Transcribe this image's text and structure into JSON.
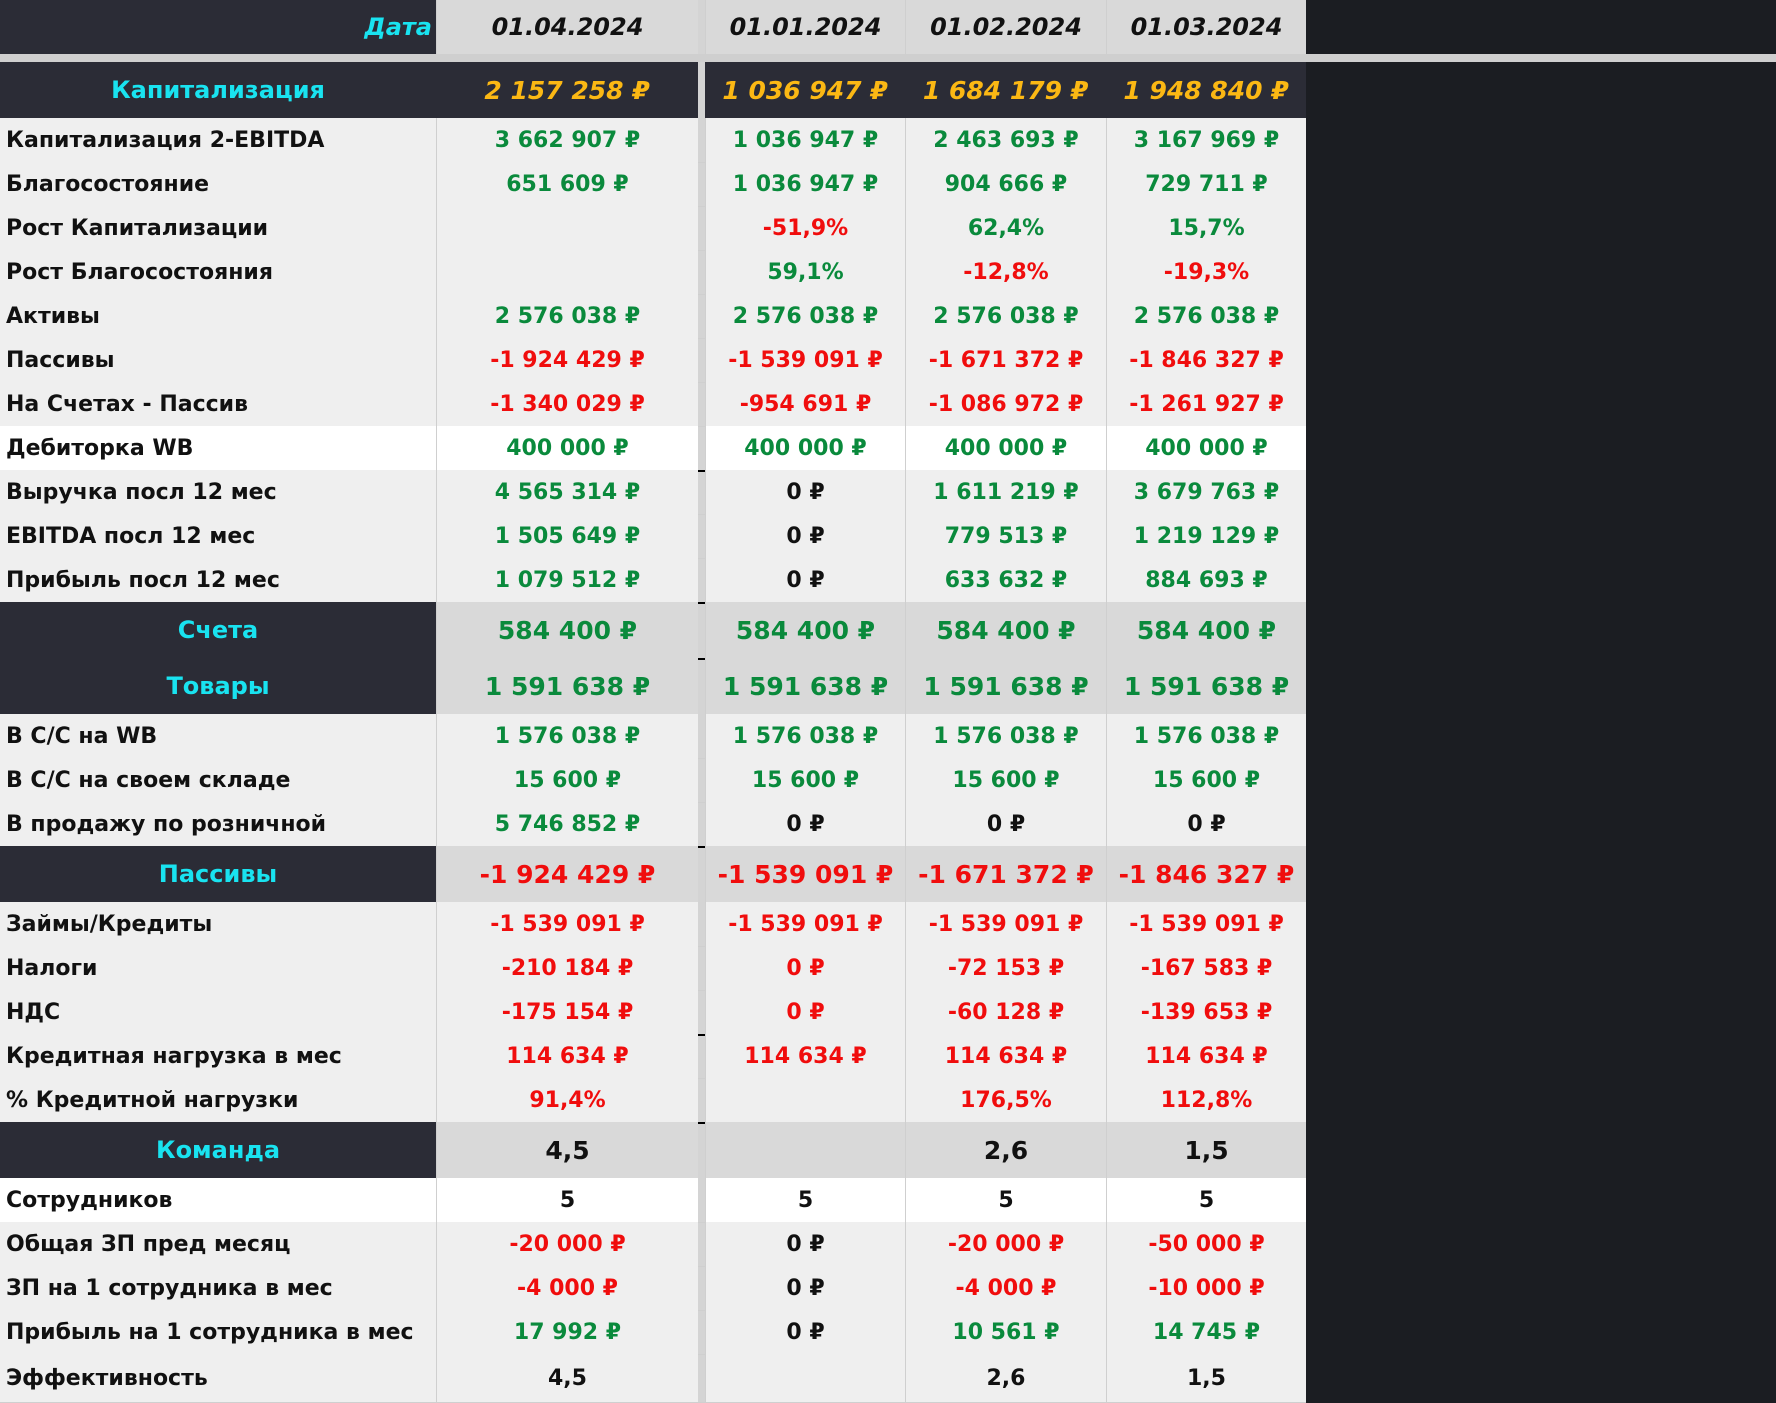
{
  "header": {
    "label": "Дата",
    "dates": [
      "01.04.2024",
      "01.01.2024",
      "01.02.2024",
      "01.03.2024"
    ]
  },
  "rows": [
    {
      "label": "Капитализация",
      "values": [
        "2 157 258 ₽",
        "1 036 947 ₽",
        "1 684 179 ₽",
        "1 948 840 ₽"
      ],
      "colors": [
        "gold",
        "gold",
        "gold",
        "gold"
      ]
    },
    {
      "label": "Капитализация 2-EBITDA",
      "values": [
        "3 662 907 ₽",
        "1 036 947 ₽",
        "2 463 693 ₽",
        "3 167 969 ₽"
      ],
      "colors": [
        "green",
        "green",
        "green",
        "green"
      ]
    },
    {
      "label": "Благосостояние",
      "values": [
        "651 609 ₽",
        "1 036 947 ₽",
        "904 666 ₽",
        "729 711 ₽"
      ],
      "colors": [
        "green",
        "green",
        "green",
        "green"
      ]
    },
    {
      "label": "Рост Капитализации",
      "values": [
        "",
        "-51,9%",
        "62,4%",
        "15,7%"
      ],
      "colors": [
        "green",
        "red",
        "green",
        "green"
      ]
    },
    {
      "label": "Рост Благосостояния",
      "values": [
        "",
        "59,1%",
        "-12,8%",
        "-19,3%"
      ],
      "colors": [
        "green",
        "green",
        "red",
        "red"
      ]
    },
    {
      "label": "Активы",
      "values": [
        "2 576 038 ₽",
        "2 576 038 ₽",
        "2 576 038 ₽",
        "2 576 038 ₽"
      ],
      "colors": [
        "green",
        "green",
        "green",
        "green"
      ]
    },
    {
      "label": "Пассивы",
      "values": [
        "-1 924 429 ₽",
        "-1 539 091 ₽",
        "-1 671 372 ₽",
        "-1 846 327 ₽"
      ],
      "colors": [
        "red",
        "red",
        "red",
        "red"
      ]
    },
    {
      "label": "На Счетах - Пассив",
      "values": [
        "-1 340 029 ₽",
        "-954 691 ₽",
        "-1 086 972 ₽",
        "-1 261 927 ₽"
      ],
      "colors": [
        "red",
        "red",
        "red",
        "red"
      ]
    },
    {
      "label": "Дебиторка WB",
      "values": [
        "400 000 ₽",
        "400 000 ₽",
        "400 000 ₽",
        "400 000 ₽"
      ],
      "colors": [
        "green",
        "green",
        "green",
        "green"
      ]
    },
    {
      "label": "Выручка посл 12 мес",
      "values": [
        "4 565 314 ₽",
        "0 ₽",
        "1 611 219 ₽",
        "3 679 763 ₽"
      ],
      "colors": [
        "green",
        "black",
        "green",
        "green"
      ]
    },
    {
      "label": "EBITDA посл 12 мес",
      "values": [
        "1 505 649 ₽",
        "0 ₽",
        "779 513 ₽",
        "1 219 129 ₽"
      ],
      "colors": [
        "green",
        "black",
        "green",
        "green"
      ]
    },
    {
      "label": "Прибыль посл 12 мес",
      "values": [
        "1 079 512 ₽",
        "0 ₽",
        "633 632 ₽",
        "884 693 ₽"
      ],
      "colors": [
        "green",
        "black",
        "green",
        "green"
      ]
    },
    {
      "label": "Счета",
      "values": [
        "584 400 ₽",
        "584 400 ₽",
        "584 400 ₽",
        "584 400 ₽"
      ],
      "colors": [
        "green",
        "green",
        "green",
        "green"
      ]
    },
    {
      "label": "Товары",
      "values": [
        "1 591 638 ₽",
        "1 591 638 ₽",
        "1 591 638 ₽",
        "1 591 638 ₽"
      ],
      "colors": [
        "green",
        "green",
        "green",
        "green"
      ]
    },
    {
      "label": "В С/С на WB",
      "values": [
        "1 576 038 ₽",
        "1 576 038 ₽",
        "1 576 038 ₽",
        "1 576 038 ₽"
      ],
      "colors": [
        "green",
        "green",
        "green",
        "green"
      ]
    },
    {
      "label": "В С/С на своем складе",
      "values": [
        "15 600 ₽",
        "15 600 ₽",
        "15 600 ₽",
        "15 600 ₽"
      ],
      "colors": [
        "green",
        "green",
        "green",
        "green"
      ]
    },
    {
      "label": "В продажу по розничной",
      "values": [
        "5 746 852 ₽",
        "0 ₽",
        "0 ₽",
        "0 ₽"
      ],
      "colors": [
        "green",
        "black",
        "black",
        "black"
      ]
    },
    {
      "label": "Пассивы",
      "values": [
        "-1 924 429 ₽",
        "-1 539 091 ₽",
        "-1 671 372 ₽",
        "-1 846 327 ₽"
      ],
      "colors": [
        "red",
        "red",
        "red",
        "red"
      ]
    },
    {
      "label": "Займы/Кредиты",
      "values": [
        "-1 539 091 ₽",
        "-1 539 091 ₽",
        "-1 539 091 ₽",
        "-1 539 091 ₽"
      ],
      "colors": [
        "red",
        "red",
        "red",
        "red"
      ]
    },
    {
      "label": "Налоги",
      "values": [
        "-210 184 ₽",
        "0 ₽",
        "-72 153 ₽",
        "-167 583 ₽"
      ],
      "colors": [
        "red",
        "red",
        "red",
        "red"
      ]
    },
    {
      "label": "НДС",
      "values": [
        "-175 154 ₽",
        "0 ₽",
        "-60 128 ₽",
        "-139 653 ₽"
      ],
      "colors": [
        "red",
        "red",
        "red",
        "red"
      ]
    },
    {
      "label": "Кредитная нагрузка в мес",
      "values": [
        "114 634 ₽",
        "114 634 ₽",
        "114 634 ₽",
        "114 634 ₽"
      ],
      "colors": [
        "red",
        "red",
        "red",
        "red"
      ]
    },
    {
      "label": "% Кредитной нагрузки",
      "values": [
        "91,4%",
        "",
        "176,5%",
        "112,8%"
      ],
      "colors": [
        "red",
        "red",
        "red",
        "red"
      ]
    },
    {
      "label": "Команда",
      "values": [
        "4,5",
        "",
        "2,6",
        "1,5"
      ],
      "colors": [
        "black",
        "black",
        "black",
        "black"
      ]
    },
    {
      "label": "Сотрудников",
      "values": [
        "5",
        "5",
        "5",
        "5"
      ],
      "colors": [
        "black",
        "black",
        "black",
        "black"
      ]
    },
    {
      "label": "Общая ЗП пред месяц",
      "values": [
        "-20 000 ₽",
        "0 ₽",
        "-20 000 ₽",
        "-50 000 ₽"
      ],
      "colors": [
        "red",
        "black",
        "red",
        "red"
      ]
    },
    {
      "label": "ЗП на 1 сотрудника в мес",
      "values": [
        "-4 000 ₽",
        "0 ₽",
        "-4 000 ₽",
        "-10 000 ₽"
      ],
      "colors": [
        "red",
        "black",
        "red",
        "red"
      ]
    },
    {
      "label": "Прибыль на 1 сотрудника в мес",
      "values": [
        "17 992 ₽",
        "0 ₽",
        "10 561 ₽",
        "14 745 ₽"
      ],
      "colors": [
        "green",
        "black",
        "green",
        "green"
      ]
    },
    {
      "label": "Эффективность",
      "values": [
        "4,5",
        "",
        "2,6",
        "1,5"
      ],
      "colors": [
        "black",
        "black",
        "black",
        "black"
      ]
    }
  ]
}
